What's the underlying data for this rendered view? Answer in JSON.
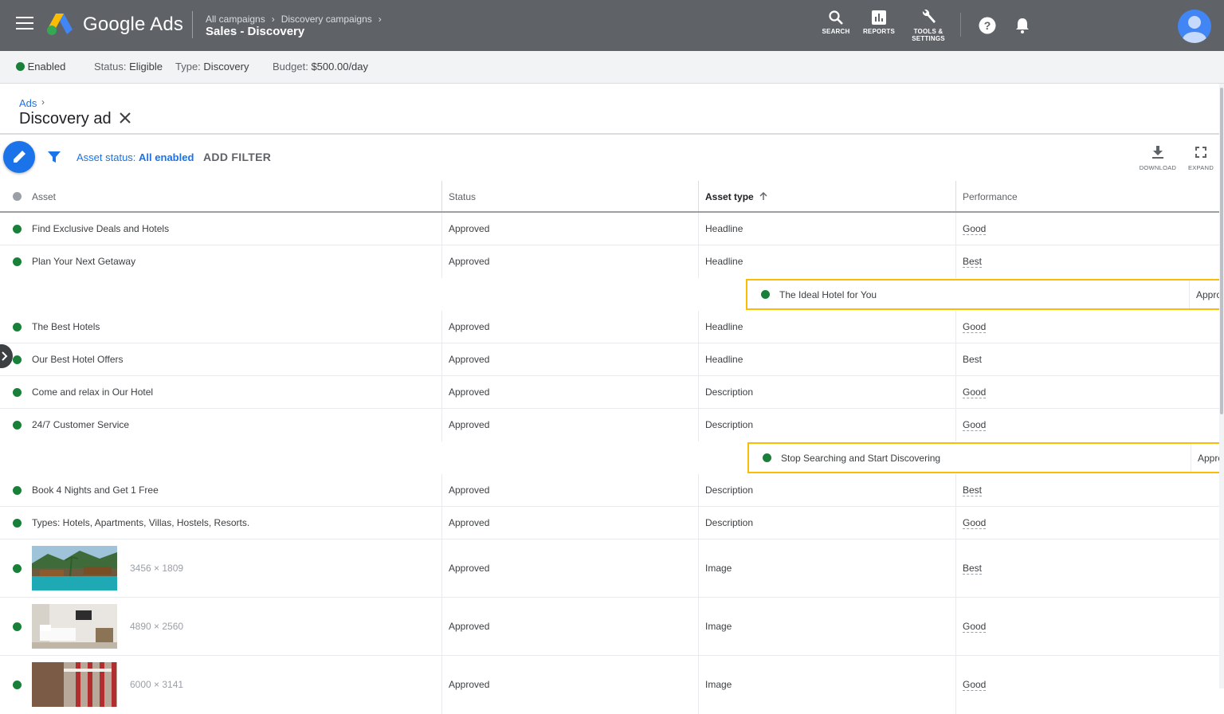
{
  "app": {
    "brand": "Google Ads"
  },
  "breadcrumb": {
    "level1": "All campaigns",
    "level2": "Discovery campaigns",
    "current": "Sales - Discovery"
  },
  "toolbar": {
    "search_label": "SEARCH",
    "reports_label": "REPORTS",
    "tools_label_1": "TOOLS &",
    "tools_label_2": "SETTINGS"
  },
  "status_bar": {
    "enabled": "Enabled",
    "status_label": "Status:",
    "status_value": "Eligible",
    "type_label": "Type:",
    "type_value": "Discovery",
    "budget_label": "Budget:",
    "budget_value": "$500.00/day"
  },
  "page": {
    "parent_link": "Ads",
    "title": "Discovery ad"
  },
  "filter": {
    "asset_status_label": "Asset status:",
    "asset_status_value": "All enabled",
    "add_filter": "ADD FILTER",
    "download": "DOWNLOAD",
    "expand": "EXPAND"
  },
  "table": {
    "headers": {
      "asset": "Asset",
      "status": "Status",
      "asset_type": "Asset type",
      "performance": "Performance"
    },
    "rows": [
      {
        "asset": "Find Exclusive Deals and Hotels",
        "status": "Approved",
        "type": "Headline",
        "performance": "Good"
      },
      {
        "asset": "Plan Your Next Getaway",
        "status": "Approved",
        "type": "Headline",
        "performance": "Best"
      },
      {
        "asset": "The Best Hotels",
        "status": "Approved",
        "type": "Headline",
        "performance": "Good"
      },
      {
        "asset": "Our Best Hotel Offers",
        "status": "Approved",
        "type": "Headline",
        "performance": "Best"
      },
      {
        "asset": "Come and relax in Our Hotel",
        "status": "Approved",
        "type": "Description",
        "performance": "Good"
      },
      {
        "asset": "24/7 Customer Service",
        "status": "Approved",
        "type": "Description",
        "performance": "Good"
      },
      {
        "asset": "Book 4 Nights and Get 1 Free",
        "status": "Approved",
        "type": "Description",
        "performance": "Best"
      },
      {
        "asset": "Types: Hotels, Apartments, Villas, Hostels, Resorts.",
        "status": "Approved",
        "type": "Description",
        "performance": "Good"
      }
    ],
    "image_rows": [
      {
        "dimensions": "3456 × 1809",
        "status": "Approved",
        "type": "Image",
        "performance": "Best"
      },
      {
        "dimensions": "4890 × 2560",
        "status": "Approved",
        "type": "Image",
        "performance": "Good"
      },
      {
        "dimensions": "6000 × 3141",
        "status": "Approved",
        "type": "Image",
        "performance": "Good"
      }
    ],
    "dragged": [
      {
        "asset": "The Ideal Hotel for You",
        "status": "Approv"
      },
      {
        "asset": "Stop Searching and Start Discovering",
        "status": "Approv"
      }
    ]
  },
  "colors": {
    "topbar": "#5f6368",
    "accent": "#1a73e8",
    "enabled_green": "#188038",
    "drag_border": "#fbbc04"
  }
}
